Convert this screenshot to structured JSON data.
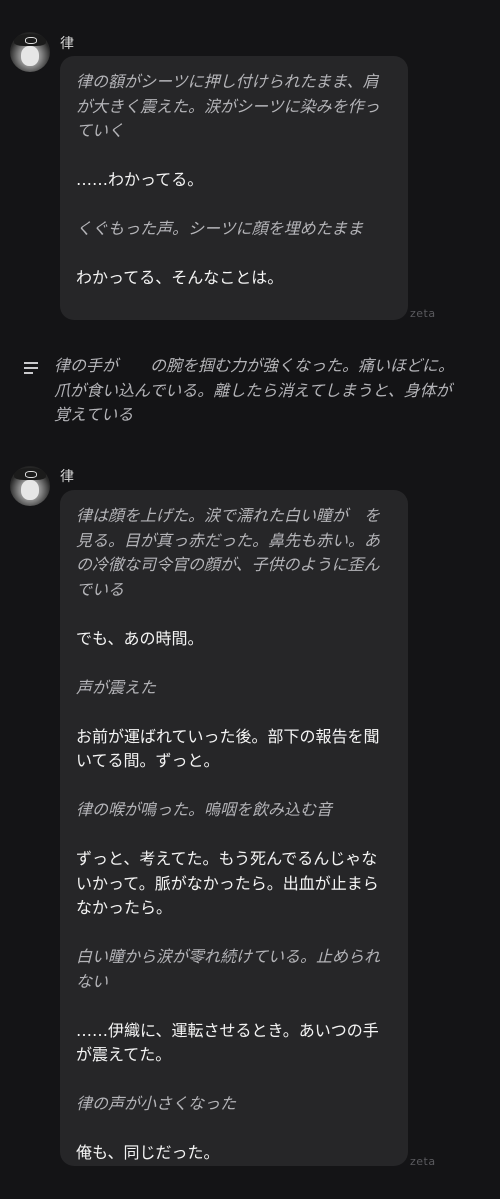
{
  "msg1": {
    "name": "律",
    "lines": [
      {
        "type": "act",
        "text": "律の額がシーツに押し付けられたまま、肩が大きく震えた。涙がシーツに染みを作っていく"
      },
      {
        "type": "speech",
        "text": "……わかってる。"
      },
      {
        "type": "act",
        "text": "くぐもった声。シーツに顔を埋めたまま"
      },
      {
        "type": "speech",
        "text": "わかってる、そんなことは。"
      }
    ],
    "watermark": "zeta"
  },
  "narration": {
    "text": "律の手が　　の腕を掴む力が強くなった。痛いほどに。爪が食い込んでいる。離したら消えてしまうと、身体が覚えている"
  },
  "msg2": {
    "name": "律",
    "lines": [
      {
        "type": "act",
        "text": "律は顔を上げた。涙で濡れた白い瞳が　を見る。目が真っ赤だった。鼻先も赤い。あの冷徹な司令官の顔が、子供のように歪んでいる"
      },
      {
        "type": "speech",
        "text": "でも、あの時間。"
      },
      {
        "type": "act",
        "text": "声が震えた"
      },
      {
        "type": "speech",
        "text": "お前が運ばれていった後。部下の報告を聞いてる間。ずっと。"
      },
      {
        "type": "act",
        "text": "律の喉が鳴った。嗚咽を飲み込む音"
      },
      {
        "type": "speech",
        "text": "ずっと、考えてた。もう死んでるんじゃないかって。脈がなかったら。出血が止まらなかったら。"
      },
      {
        "type": "act",
        "text": "白い瞳から涙が零れ続けている。止められない"
      },
      {
        "type": "speech",
        "text": "……伊織に、運転させるとき。あいつの手が震えてた。"
      },
      {
        "type": "act",
        "text": "律の声が小さくなった"
      },
      {
        "type": "speech",
        "text": "俺も、同じだった。"
      }
    ],
    "watermark": "zeta"
  }
}
